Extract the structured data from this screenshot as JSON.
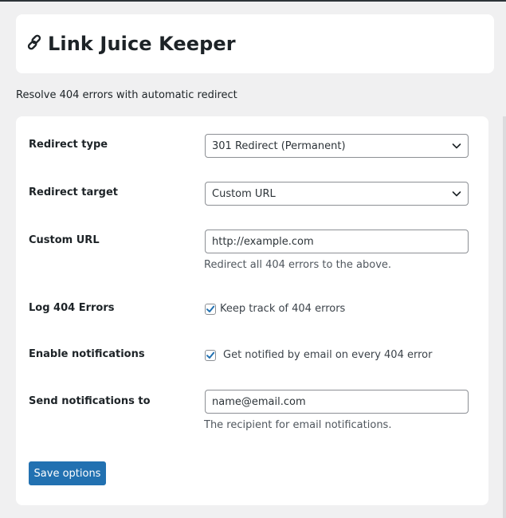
{
  "header": {
    "title": "Link Juice Keeper",
    "icon": "link-icon"
  },
  "subtitle": "Resolve 404 errors with automatic redirect",
  "form": {
    "redirect_type": {
      "label": "Redirect type",
      "value": "301 Redirect (Permanent)"
    },
    "redirect_target": {
      "label": "Redirect target",
      "value": "Custom URL"
    },
    "custom_url": {
      "label": "Custom URL",
      "value": "http://example.com",
      "help": "Redirect all 404 errors to the above."
    },
    "log_errors": {
      "label": "Log 404 Errors",
      "checked": true,
      "checkbox_label": "Keep track of 404 errors"
    },
    "notifications": {
      "label": "Enable notifications",
      "checked": true,
      "checkbox_label": "Get notified by email on every 404 error"
    },
    "notify_email": {
      "label": "Send notifications to",
      "value": "name@email.com",
      "help": "The recipient for email notifications."
    },
    "save_label": "Save options"
  },
  "colors": {
    "accent": "#2271b1",
    "background": "#f0f0f1",
    "card": "#ffffff",
    "text": "#1d2327"
  }
}
